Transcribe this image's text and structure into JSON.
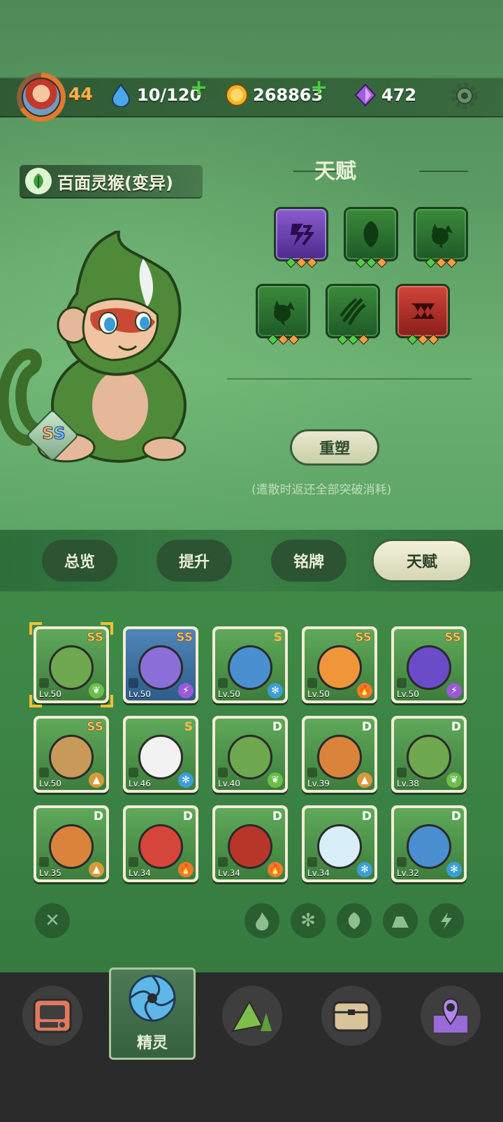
{
  "header": {
    "player_level": "44",
    "stamina": "10/120",
    "coins": "268863",
    "gems": "472"
  },
  "pet": {
    "name": "百面灵猴(变异)",
    "rarity": "SS"
  },
  "talent": {
    "title": "天赋",
    "reshape_label": "重塑",
    "note": "(遣散时返还全部突破消耗)"
  },
  "tabs": [
    {
      "label": "总览"
    },
    {
      "label": "提升"
    },
    {
      "label": "铭牌"
    },
    {
      "label": "天赋"
    }
  ],
  "pets": [
    {
      "rank": "SS",
      "level": "Lv.50",
      "element": "leaf-icon",
      "color": "#6abf4b"
    },
    {
      "rank": "SS",
      "level": "Lv.50",
      "element": "lightning-icon",
      "color": "#9b59d6"
    },
    {
      "rank": "S",
      "level": "Lv.50",
      "element": "ice-icon",
      "color": "#3a9fd8"
    },
    {
      "rank": "SS",
      "level": "Lv.50",
      "element": "fire-icon",
      "color": "#f07a2a"
    },
    {
      "rank": "SS",
      "level": "Lv.50",
      "element": "lightning-icon",
      "color": "#9b59d6"
    },
    {
      "rank": "SS",
      "level": "Lv.50",
      "element": "earth-icon",
      "color": "#d99a3a"
    },
    {
      "rank": "S",
      "level": "Lv.46",
      "element": "ice-icon",
      "color": "#3a9fd8"
    },
    {
      "rank": "D",
      "level": "Lv.40",
      "element": "leaf-icon",
      "color": "#6abf4b"
    },
    {
      "rank": "D",
      "level": "Lv.39",
      "element": "earth-icon",
      "color": "#d99a3a"
    },
    {
      "rank": "D",
      "level": "Lv.38",
      "element": "leaf-icon",
      "color": "#6abf4b"
    },
    {
      "rank": "D",
      "level": "Lv.35",
      "element": "earth-icon",
      "color": "#d99a3a"
    },
    {
      "rank": "D",
      "level": "Lv.34",
      "element": "fire-icon",
      "color": "#f07a2a"
    },
    {
      "rank": "D",
      "level": "Lv.34",
      "element": "fire-icon",
      "color": "#f07a2a"
    },
    {
      "rank": "D",
      "level": "Lv.34",
      "element": "ice-icon",
      "color": "#3a9fd8"
    },
    {
      "rank": "D",
      "level": "Lv.32",
      "element": "ice-icon",
      "color": "#3a9fd8"
    }
  ],
  "nav": {
    "active_label": "精灵"
  }
}
